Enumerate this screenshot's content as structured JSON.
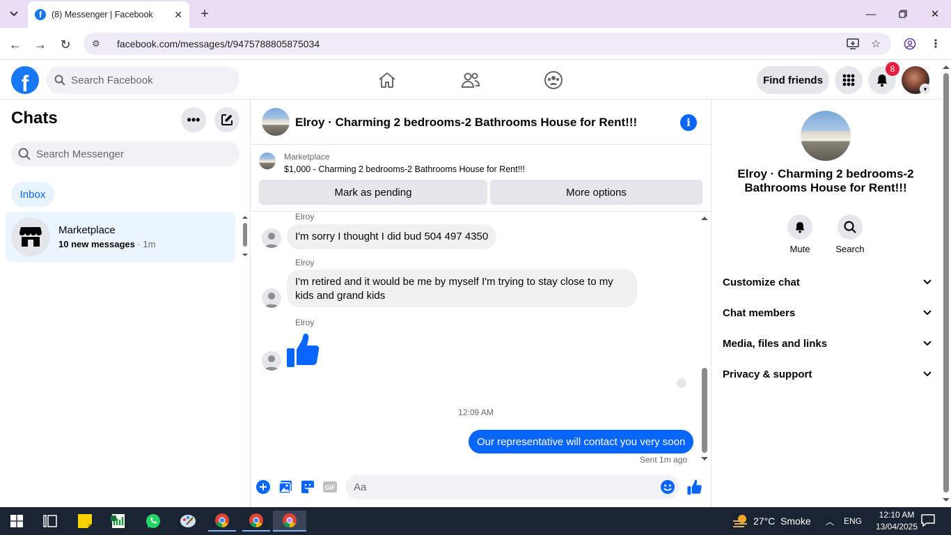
{
  "browser": {
    "tab_title": "(8) Messenger | Facebook",
    "url": "facebook.com/messages/t/9475788805875034"
  },
  "header": {
    "search_placeholder": "Search Facebook",
    "find_friends": "Find friends",
    "notification_count": "8"
  },
  "left": {
    "title": "Chats",
    "search_placeholder": "Search Messenger",
    "inbox_label": "Inbox",
    "chats": [
      {
        "name": "Marketplace",
        "unread": "10 new messages",
        "time": "1m"
      }
    ]
  },
  "conversation": {
    "title": "Elroy · Charming 2 bedrooms-2 Bathrooms House for Rent!!!",
    "marketplace_label": "Marketplace",
    "listing": "$1,000 - Charming 2 bedrooms-2 Bathrooms House for Rent!!!",
    "mark_pending": "Mark as pending",
    "more_options": "More options",
    "messages": [
      {
        "sender": "Elroy",
        "text": "I'm sorry I thought I did bud  504 497 4350"
      },
      {
        "sender": "Elroy",
        "text": "I'm retired and it would be me by myself I'm trying to stay close to my kids and grand kids"
      },
      {
        "sender": "Elroy",
        "type": "like-sticker"
      }
    ],
    "timestamp": "12:09 AM",
    "outgoing": "Our representative will contact you very soon",
    "sent_status": "Sent 1m ago",
    "composer_placeholder": "Aa"
  },
  "right": {
    "name": "Elroy · Charming 2 bedrooms-2 Bathrooms House for Rent!!!",
    "actions": [
      "Mute",
      "Search"
    ],
    "sections": [
      "Customize chat",
      "Chat members",
      "Media, files and links",
      "Privacy & support"
    ]
  },
  "taskbar": {
    "weather": "27°C  Smoke",
    "lang": "ENG",
    "time": "12:10 AM",
    "date": "13/04/2025"
  },
  "colors": {
    "accent": "#0866ff",
    "fb_blue": "#1877f2",
    "badge": "#e41e3f",
    "tabbar": "#e9def5"
  }
}
